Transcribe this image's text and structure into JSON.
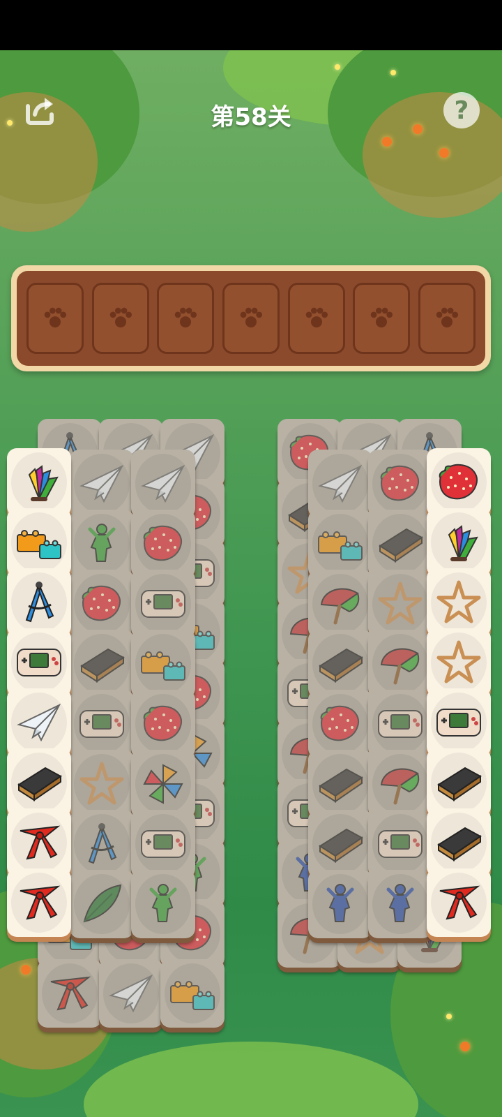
{
  "level": {
    "title": "第58关"
  },
  "header": {
    "share_icon": "share-icon",
    "help_icon": "help-icon",
    "help_glyph": "?"
  },
  "tray": {
    "slot_count": 7,
    "slot_icon": "paw-icon"
  },
  "left_column": {
    "items": [
      "shuttlecock",
      "toy-bricks",
      "compass",
      "game-console",
      "paper-plane",
      "chalkboard-eraser",
      "red-scarf",
      "red-scarf"
    ]
  },
  "right_column": {
    "items": [
      "strawberry",
      "shuttlecock",
      "star",
      "star",
      "game-console",
      "chalkboard-eraser",
      "chalkboard-eraser",
      "red-scarf"
    ]
  },
  "colors": {
    "tray_border": "#f1d8a6",
    "tray_fill": "#8c4a2c",
    "tile_face": "#fbf3e4",
    "tile_edge": "#c58552",
    "title_text": "#ffffff"
  }
}
